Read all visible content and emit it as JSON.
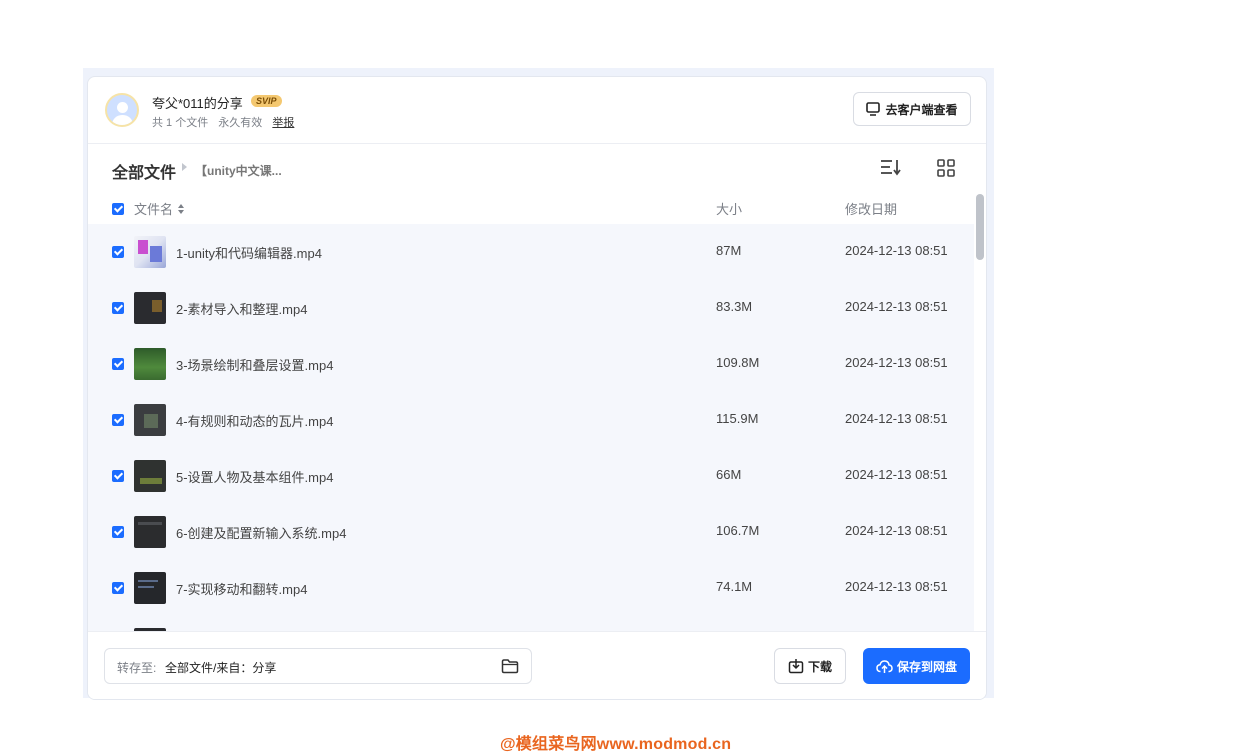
{
  "header": {
    "owner": "夸父*011的分享",
    "badge": "SVIP",
    "file_count": "共 1 个文件",
    "validity": "永久有效",
    "report": "举报",
    "client_button": "去客户端查看"
  },
  "toolbar": {
    "breadcrumb_root": "全部文件",
    "breadcrumb_current": "【unity中文课..."
  },
  "table": {
    "col_name": "文件名",
    "col_size": "大小",
    "col_date": "修改日期",
    "rows": [
      {
        "name": "1-unity和代码编辑器.mp4",
        "size": "87M",
        "date": "2024-12-13 08:51"
      },
      {
        "name": "2-素材导入和整理.mp4",
        "size": "83.3M",
        "date": "2024-12-13 08:51"
      },
      {
        "name": "3-场景绘制和叠层设置.mp4",
        "size": "109.8M",
        "date": "2024-12-13 08:51"
      },
      {
        "name": "4-有规则和动态的瓦片.mp4",
        "size": "115.9M",
        "date": "2024-12-13 08:51"
      },
      {
        "name": "5-设置人物及基本组件.mp4",
        "size": "66M",
        "date": "2024-12-13 08:51"
      },
      {
        "name": "6-创建及配置新输入系统.mp4",
        "size": "106.7M",
        "date": "2024-12-13 08:51"
      },
      {
        "name": "7-实现移动和翻转.mp4",
        "size": "74.1M",
        "date": "2024-12-13 08:51"
      }
    ]
  },
  "footer": {
    "dest_label": "转存至:",
    "dest_path": "全部文件/来自：分享",
    "download": "下载",
    "save": "保存到网盘"
  },
  "watermark": "@模组菜鸟网www.modmod.cn",
  "colors": {
    "accent": "#1b6cff",
    "watermark": "#e9651f"
  }
}
